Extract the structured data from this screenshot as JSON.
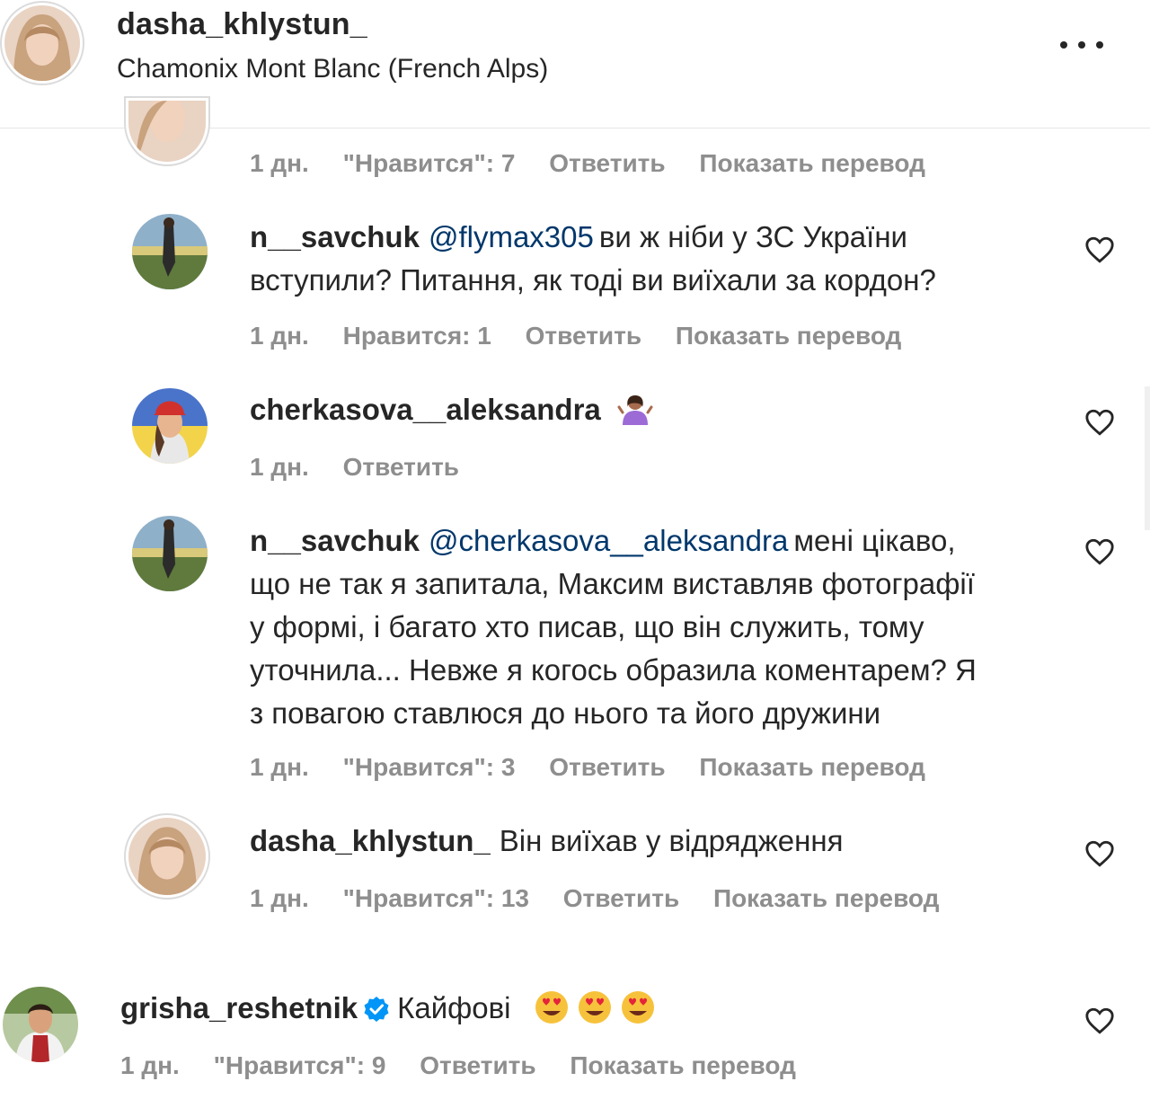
{
  "post": {
    "username": "dasha_khlystun_",
    "location": "Chamonix Mont Blanc (French Alps)"
  },
  "prev_meta": {
    "time": "1 дн.",
    "likes": "\"Нравится\": 7",
    "reply": "Ответить",
    "translate": "Показать перевод"
  },
  "comments": [
    {
      "username": "n__savchuk",
      "mention": "@flymax305",
      "line1": "ви ж ніби у ЗС України",
      "line2": "вступили? Питання, як тоді ви виїхали за кордон?",
      "time": "1 дн.",
      "likes": "Нравится: 1",
      "reply": "Ответить",
      "translate": "Показать перевод"
    },
    {
      "username": "cherkasova__aleksandra",
      "emoji": "person-shrugging-emoji",
      "time": "1 дн.",
      "reply": "Ответить"
    },
    {
      "username": "n__savchuk",
      "mention": "@cherkasova__aleksandra",
      "line1": "мені цікаво,",
      "line2": "що не так я запитала, Максим виставляв фотографії",
      "line3": "у формі, і багато хто писав, що він служить, тому",
      "line4": "уточнила... Невже я когось образила коментарем? Я",
      "line5": "з повагою ставлюся до нього та його дружини",
      "time": "1 дн.",
      "likes": "\"Нравится\": 3",
      "reply": "Ответить",
      "translate": "Показать перевод"
    },
    {
      "username": "dasha_khlystun_",
      "text": "Він виїхав у відрядження",
      "time": "1 дн.",
      "likes": "\"Нравится\": 13",
      "reply": "Ответить",
      "translate": "Показать перевод"
    },
    {
      "username": "grisha_reshetnik",
      "verified": true,
      "text": "Кайфові",
      "emoji": "smiling-face-with-heart-eyes-emoji",
      "time": "1 дн.",
      "likes": "\"Нравится\": 9",
      "reply": "Ответить",
      "translate": "Показать перевод"
    }
  ],
  "colors": {
    "text": "#262626",
    "secondary": "#8e8e8e",
    "mention": "#00376b",
    "verified": "#0095f6",
    "divider": "#e6e6e6"
  }
}
